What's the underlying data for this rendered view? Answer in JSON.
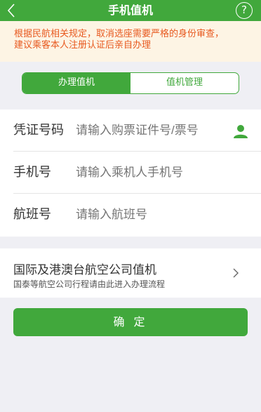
{
  "header": {
    "title": "手机值机"
  },
  "notice": {
    "line1": "根据民航相关规定，取消选座需要严格的身份审查，",
    "line2": "建议乘客本人注册认证后亲自办理"
  },
  "tabs": [
    {
      "label": "办理值机"
    },
    {
      "label": "值机管理"
    }
  ],
  "form": {
    "fields": [
      {
        "label": "凭证号码",
        "placeholder": "请输入购票证件号/票号"
      },
      {
        "label": "手机号",
        "placeholder": "请输入乘机人手机号"
      },
      {
        "label": "航班号",
        "placeholder": "请输入航班号"
      }
    ]
  },
  "intl": {
    "title": "国际及港澳台航空公司值机",
    "subtitle": "国泰等航空公司行程请由此进入办理流程"
  },
  "confirm_label": "确 定",
  "colors": {
    "accent": "#41a83c",
    "notice_text": "#e8591f",
    "notice_bg": "#fdf4e4"
  }
}
